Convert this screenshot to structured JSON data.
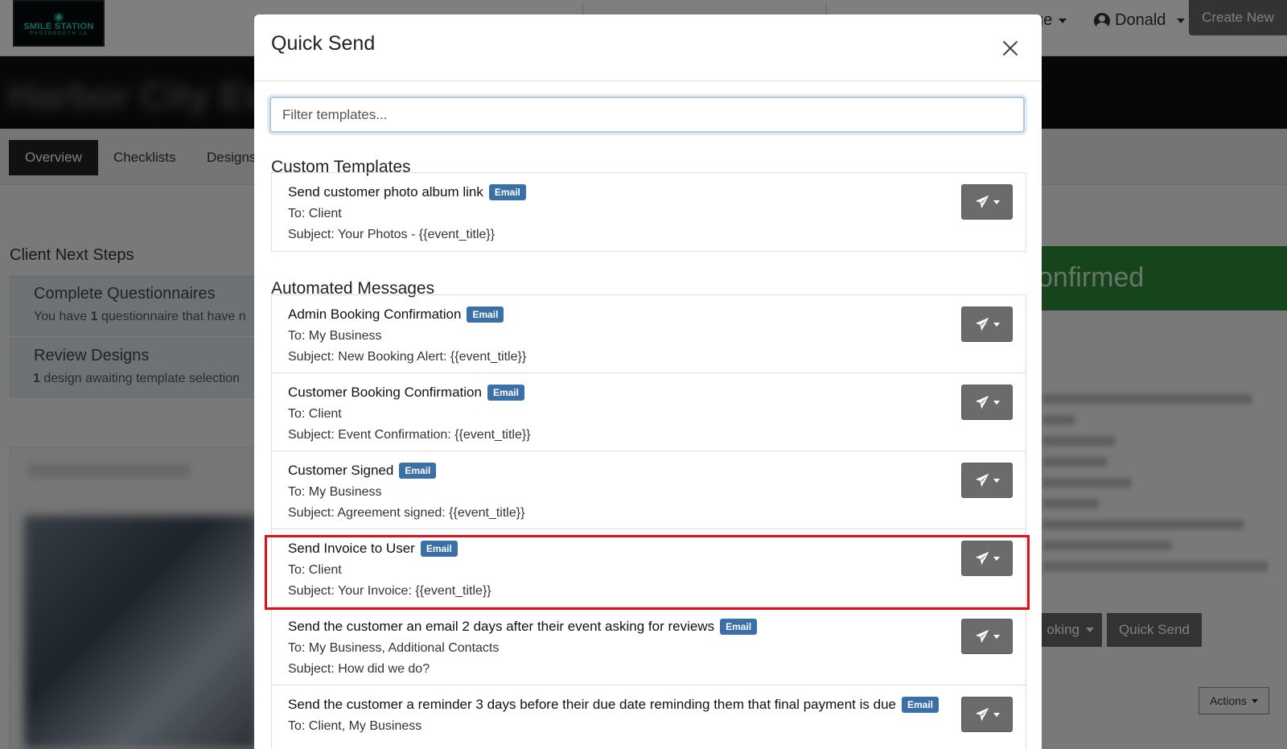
{
  "background": {
    "logo": {
      "name": "SMILE STATION",
      "sub": "PHOTOBOOTH LA"
    },
    "nav_page_fragment": "ge",
    "user_name": "Donald",
    "create_new_label": "Create New",
    "tabs": [
      {
        "label": "Overview",
        "active": true
      },
      {
        "label": "Checklists",
        "active": false
      },
      {
        "label": "Designs",
        "active": false
      }
    ],
    "client_next_steps_title": "Client Next Steps",
    "steps": [
      {
        "title": "Complete Questionnaires",
        "count": "1",
        "text": " questionnaire that have n",
        "prefix": "You have "
      },
      {
        "title": "Review Designs",
        "count": "1",
        "text": " design awaiting template selection",
        "prefix": ""
      }
    ],
    "status_fragment": "onfirmed",
    "booking_fragment": "oking",
    "quick_send_label": "Quick Send",
    "actions_label": "Actions"
  },
  "modal": {
    "title": "Quick Send",
    "filter_placeholder": "Filter templates...",
    "custom_title": "Custom Templates",
    "custom_templates": [
      {
        "name": "Send customer photo album link",
        "badge": "Email",
        "to": "To: Client",
        "subject": "Subject: Your Photos - {{event_title}}"
      }
    ],
    "automated_title": "Automated Messages",
    "automated_messages": [
      {
        "name": "Admin Booking Confirmation",
        "badge": "Email",
        "to": "To: My Business",
        "subject": "Subject: New Booking Alert: {{event_title}}"
      },
      {
        "name": "Customer Booking Confirmation",
        "badge": "Email",
        "to": "To: Client",
        "subject": "Subject: Event Confirmation: {{event_title}}"
      },
      {
        "name": "Customer Signed",
        "badge": "Email",
        "to": "To: My Business",
        "subject": "Subject: Agreement signed: {{event_title}}"
      },
      {
        "name": "Send Invoice to User",
        "badge": "Email",
        "to": "To: Client",
        "subject": "Subject: Your Invoice: {{event_title}}"
      },
      {
        "name": "Send the customer an email 2 days after their event asking for reviews",
        "badge": "Email",
        "to": "To: My Business, Additional Contacts",
        "subject": "Subject: How did we do?"
      },
      {
        "name": "Send the customer a reminder 3 days before their due date reminding them that final payment is due",
        "badge": "Email",
        "to": "To: Client, My Business",
        "subject": ""
      }
    ],
    "highlight_color": "#e0101a",
    "badge_color": "#3b6fa8"
  }
}
